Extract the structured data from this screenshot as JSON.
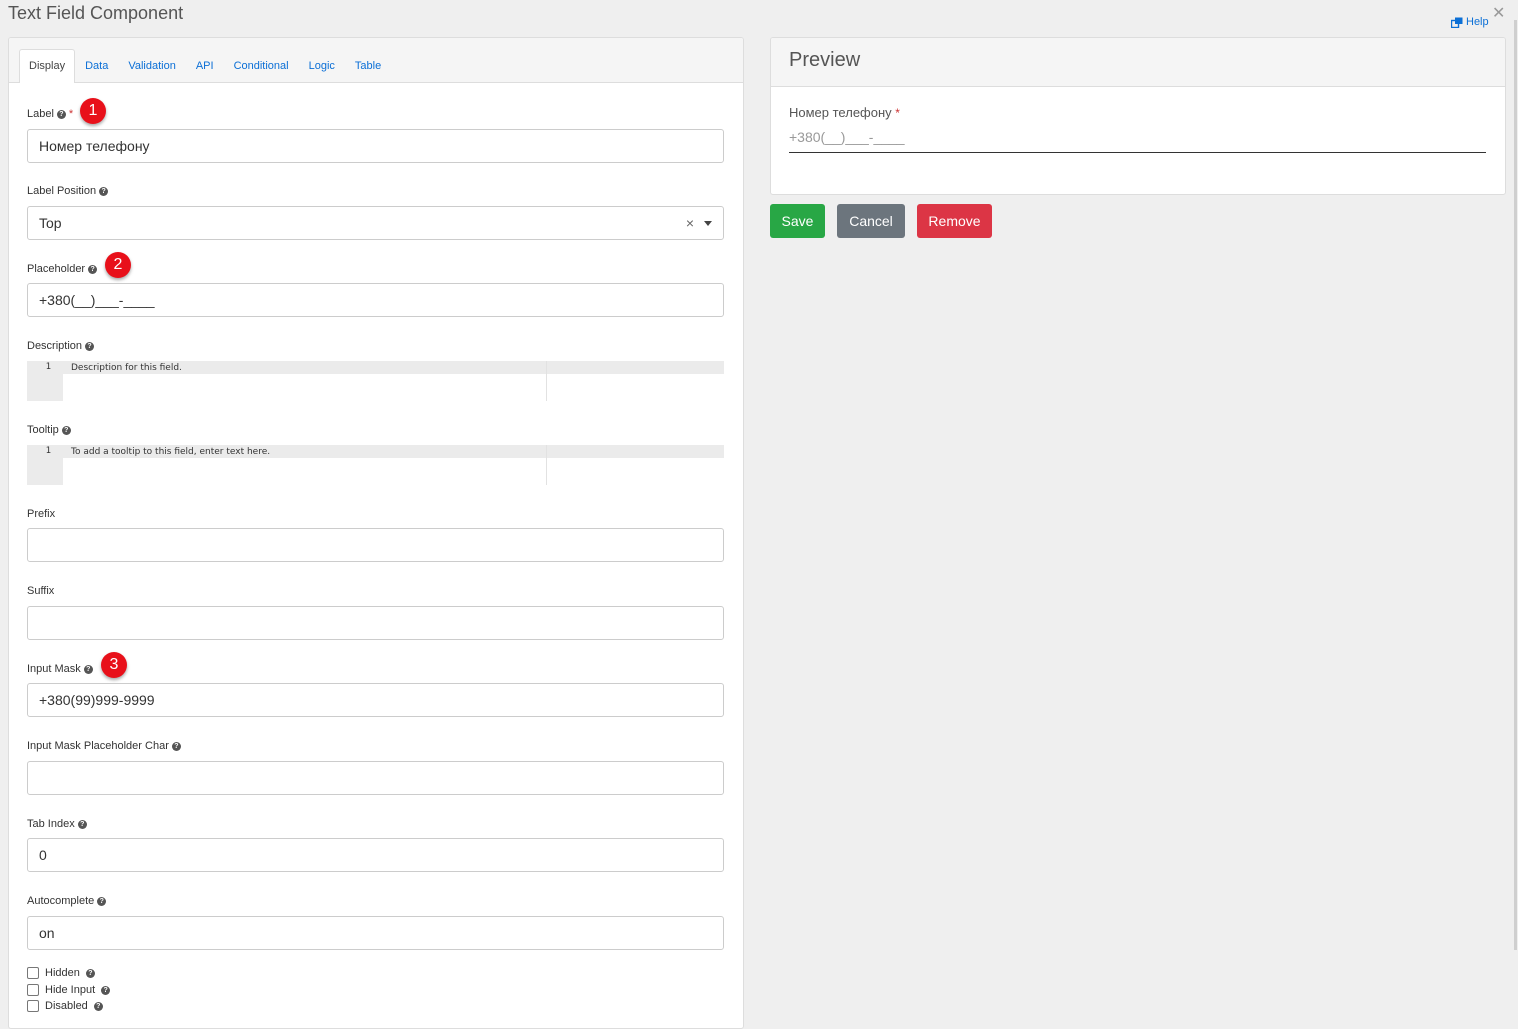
{
  "dialog": {
    "title": "Text Field Component",
    "help_label": "Help",
    "close_glyph": "✕"
  },
  "tabs": [
    {
      "label": "Display",
      "active": true
    },
    {
      "label": "Data"
    },
    {
      "label": "Validation"
    },
    {
      "label": "API"
    },
    {
      "label": "Conditional"
    },
    {
      "label": "Logic"
    },
    {
      "label": "Table"
    }
  ],
  "form": {
    "label": {
      "label": "Label",
      "value": "Номер телефону",
      "required": "*"
    },
    "label_position": {
      "label": "Label Position",
      "value": "Top"
    },
    "placeholder": {
      "label": "Placeholder",
      "value": "+380(__)___-____"
    },
    "description": {
      "label": "Description",
      "line_number": "1",
      "text": "Description for this field."
    },
    "tooltip": {
      "label": "Tooltip",
      "line_number": "1",
      "text": "To add a tooltip to this field, enter text here."
    },
    "prefix": {
      "label": "Prefix",
      "value": ""
    },
    "suffix": {
      "label": "Suffix",
      "value": ""
    },
    "input_mask": {
      "label": "Input Mask",
      "value": "+380(99)999-9999"
    },
    "mask_placeholder_char": {
      "label": "Input Mask Placeholder Char",
      "value": ""
    },
    "tab_index": {
      "label": "Tab Index",
      "value": "0"
    },
    "autocomplete": {
      "label": "Autocomplete",
      "value": "on"
    },
    "checkboxes": [
      {
        "label": "Hidden",
        "checked": false
      },
      {
        "label": "Hide Input",
        "checked": false
      },
      {
        "label": "Disabled",
        "checked": false
      }
    ]
  },
  "badges": [
    "1",
    "2",
    "3"
  ],
  "preview": {
    "title": "Preview",
    "field_label": "Номер телефону",
    "required": "*",
    "placeholder": "+380(__)___-____"
  },
  "buttons": {
    "save": "Save",
    "cancel": "Cancel",
    "remove": "Remove"
  },
  "colors": {
    "accent_link": "#0b6fd6",
    "save": "#28a745",
    "cancel": "#6c757d",
    "remove": "#dc3545",
    "badge": "#e8101a"
  }
}
